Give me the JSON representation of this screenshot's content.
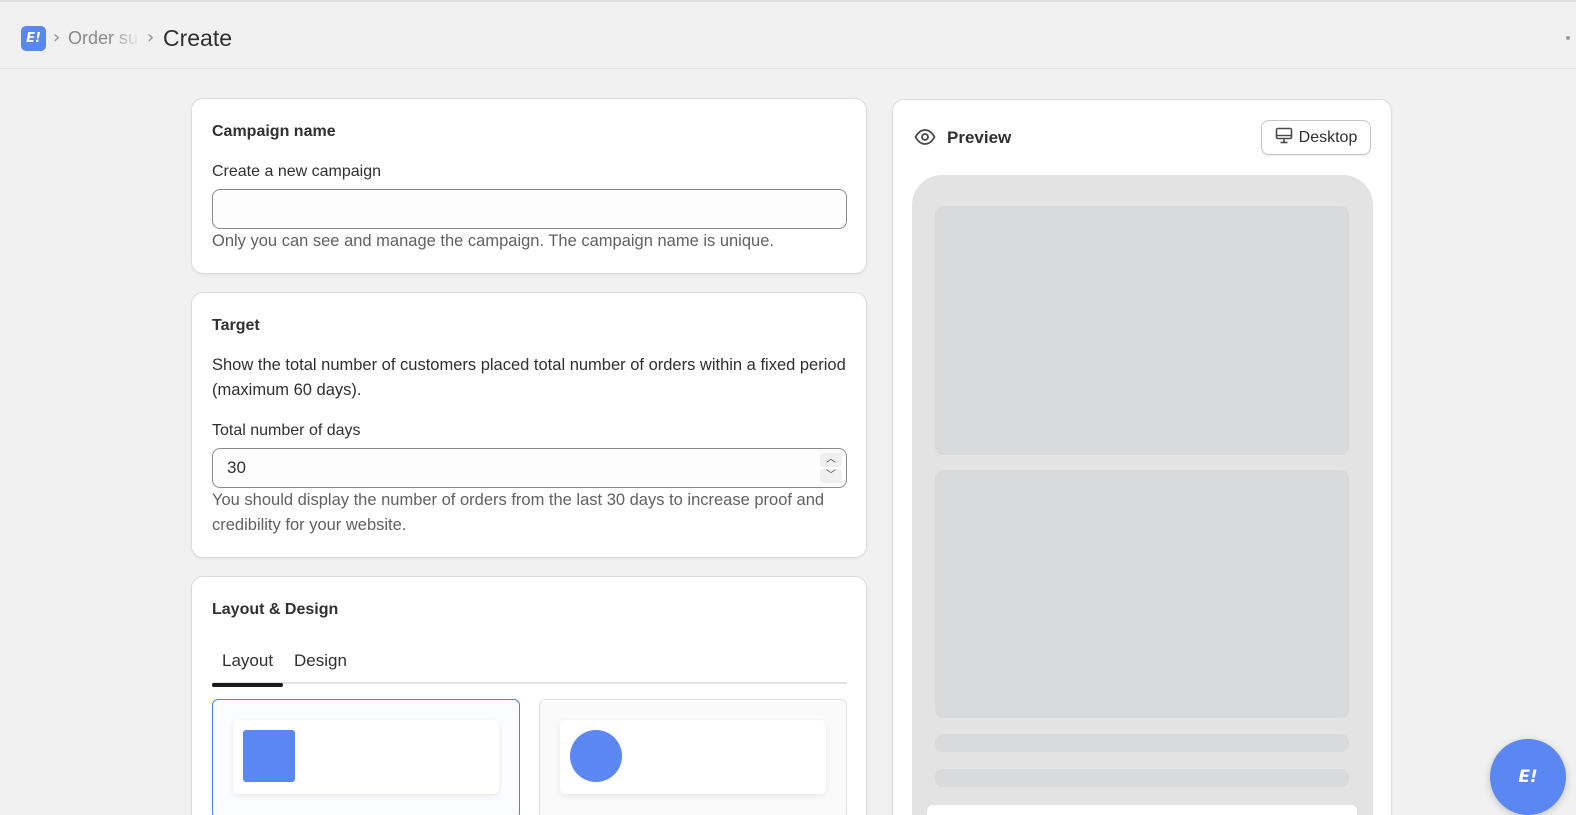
{
  "header": {
    "logo_text": "E!",
    "breadcrumb_parent": "Order su",
    "breadcrumb_current": "Create"
  },
  "campaign": {
    "title": "Campaign name",
    "field_label": "Create a new campaign",
    "field_value": "",
    "help": "Only you can see and manage the campaign. The campaign name is unique."
  },
  "target": {
    "title": "Target",
    "description": "Show the total number of customers placed total number of orders within a fixed period (maximum 60 days).",
    "days_label": "Total number of days",
    "days_value": "30",
    "help": "You should display the number of orders from the last 30 days to increase proof and credibility for your website."
  },
  "layout_design": {
    "title": "Layout & Design",
    "tabs": [
      {
        "label": "Layout",
        "active": true
      },
      {
        "label": "Design",
        "active": false
      }
    ],
    "options": [
      {
        "shape": "square",
        "selected": true
      },
      {
        "shape": "circle",
        "selected": false
      }
    ]
  },
  "preview": {
    "title": "Preview",
    "device_label": "Desktop"
  },
  "chat": {
    "fab_text": "E!"
  },
  "colors": {
    "accent": "#5b87f2",
    "selected_border": "#4f7ef0",
    "page_bg": "#f1f1f1"
  },
  "icons": {
    "preview": "eye-icon",
    "device": "monitor-icon",
    "stepper_up": "chevron-up-icon",
    "stepper_down": "chevron-down-icon"
  }
}
